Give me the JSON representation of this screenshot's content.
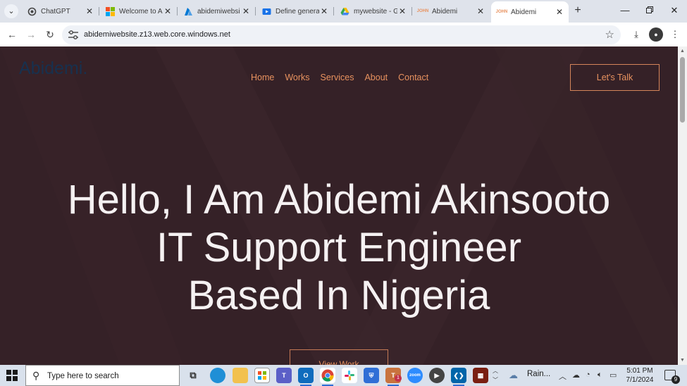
{
  "browser": {
    "tabs": [
      {
        "title": "ChatGPT",
        "favicon": "chatgpt-icon",
        "fav_color": "#444444"
      },
      {
        "title": "Welcome to A",
        "favicon": "microsoft-icon",
        "fav_color": "#f25022"
      },
      {
        "title": "abidemiwebsi",
        "favicon": "azure-icon",
        "fav_color": "#0078d4"
      },
      {
        "title": "Define genera",
        "favicon": "video-icon",
        "fav_color": "#1a73e8"
      },
      {
        "title": "mywebsite - G",
        "favicon": "google-drive-icon",
        "fav_color": "#34a853"
      },
      {
        "title": "Abidemi",
        "favicon": "site-logo-icon",
        "fav_color": "#e8925f"
      },
      {
        "title": "Abidemi",
        "favicon": "site-logo-icon",
        "fav_color": "#e8925f",
        "active": true
      }
    ],
    "favicon_text": "JOHN",
    "url": "abidemiwebsite.z13.web.core.windows.net"
  },
  "site": {
    "logo": "Abidemi.",
    "nav": [
      "Home",
      "Works",
      "Services",
      "About",
      "Contact"
    ],
    "cta": "Let's Talk",
    "hero": {
      "line1": "Hello, I Am Abidemi Akinsooto",
      "line2": "IT Support Engineer",
      "line3": "Based In Nigeria"
    },
    "secondary_button": "View Work",
    "colors": {
      "background": "#352127",
      "accent": "#e8925f",
      "logo": "#17314f",
      "hero_text": "#f5f1f2"
    }
  },
  "taskbar": {
    "search_placeholder": "Type here to search",
    "weather": "Rain...",
    "time": "5:01 PM",
    "date": "7/1/2024",
    "notification_count": "9",
    "teams_badge": "1"
  }
}
